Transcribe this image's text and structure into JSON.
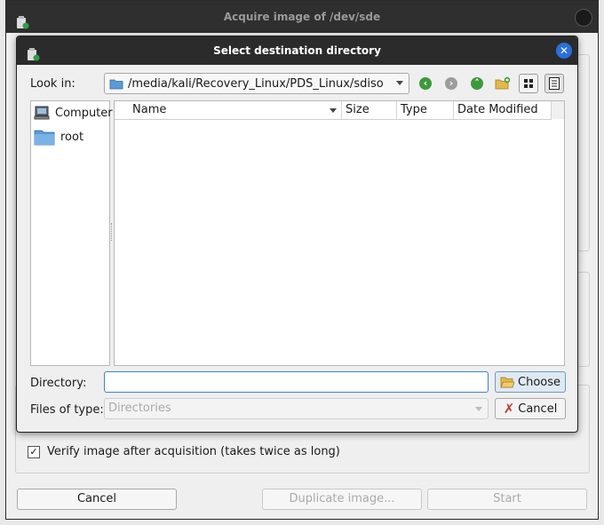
{
  "background_window": {
    "title": "Acquire image of /dev/sde",
    "verify_checkbox": {
      "label": "Verify image after acquisition (takes twice as long)",
      "checked": true
    },
    "buttons": {
      "cancel": "Cancel",
      "duplicate": "Duplicate image...",
      "start": "Start"
    }
  },
  "dialog": {
    "title": "Select destination directory",
    "look_in_label": "Look in:",
    "current_path": "/media/kali/Recovery_Linux/PDS_Linux/sdiso",
    "places": [
      {
        "label": "Computer",
        "icon": "computer-icon"
      },
      {
        "label": "root",
        "icon": "folder-icon"
      }
    ],
    "columns": [
      "Name",
      "Size",
      "Type",
      "Date Modified"
    ],
    "directory_label": "Directory:",
    "directory_value": "",
    "files_of_type_label": "Files of type:",
    "files_of_type_value": "Directories",
    "choose_label": "Choose",
    "cancel_label": "Cancel"
  },
  "colors": {
    "titlebar": "#2b2b2b",
    "close_button": "#2a6fdc",
    "focus": "#3b82d6"
  }
}
